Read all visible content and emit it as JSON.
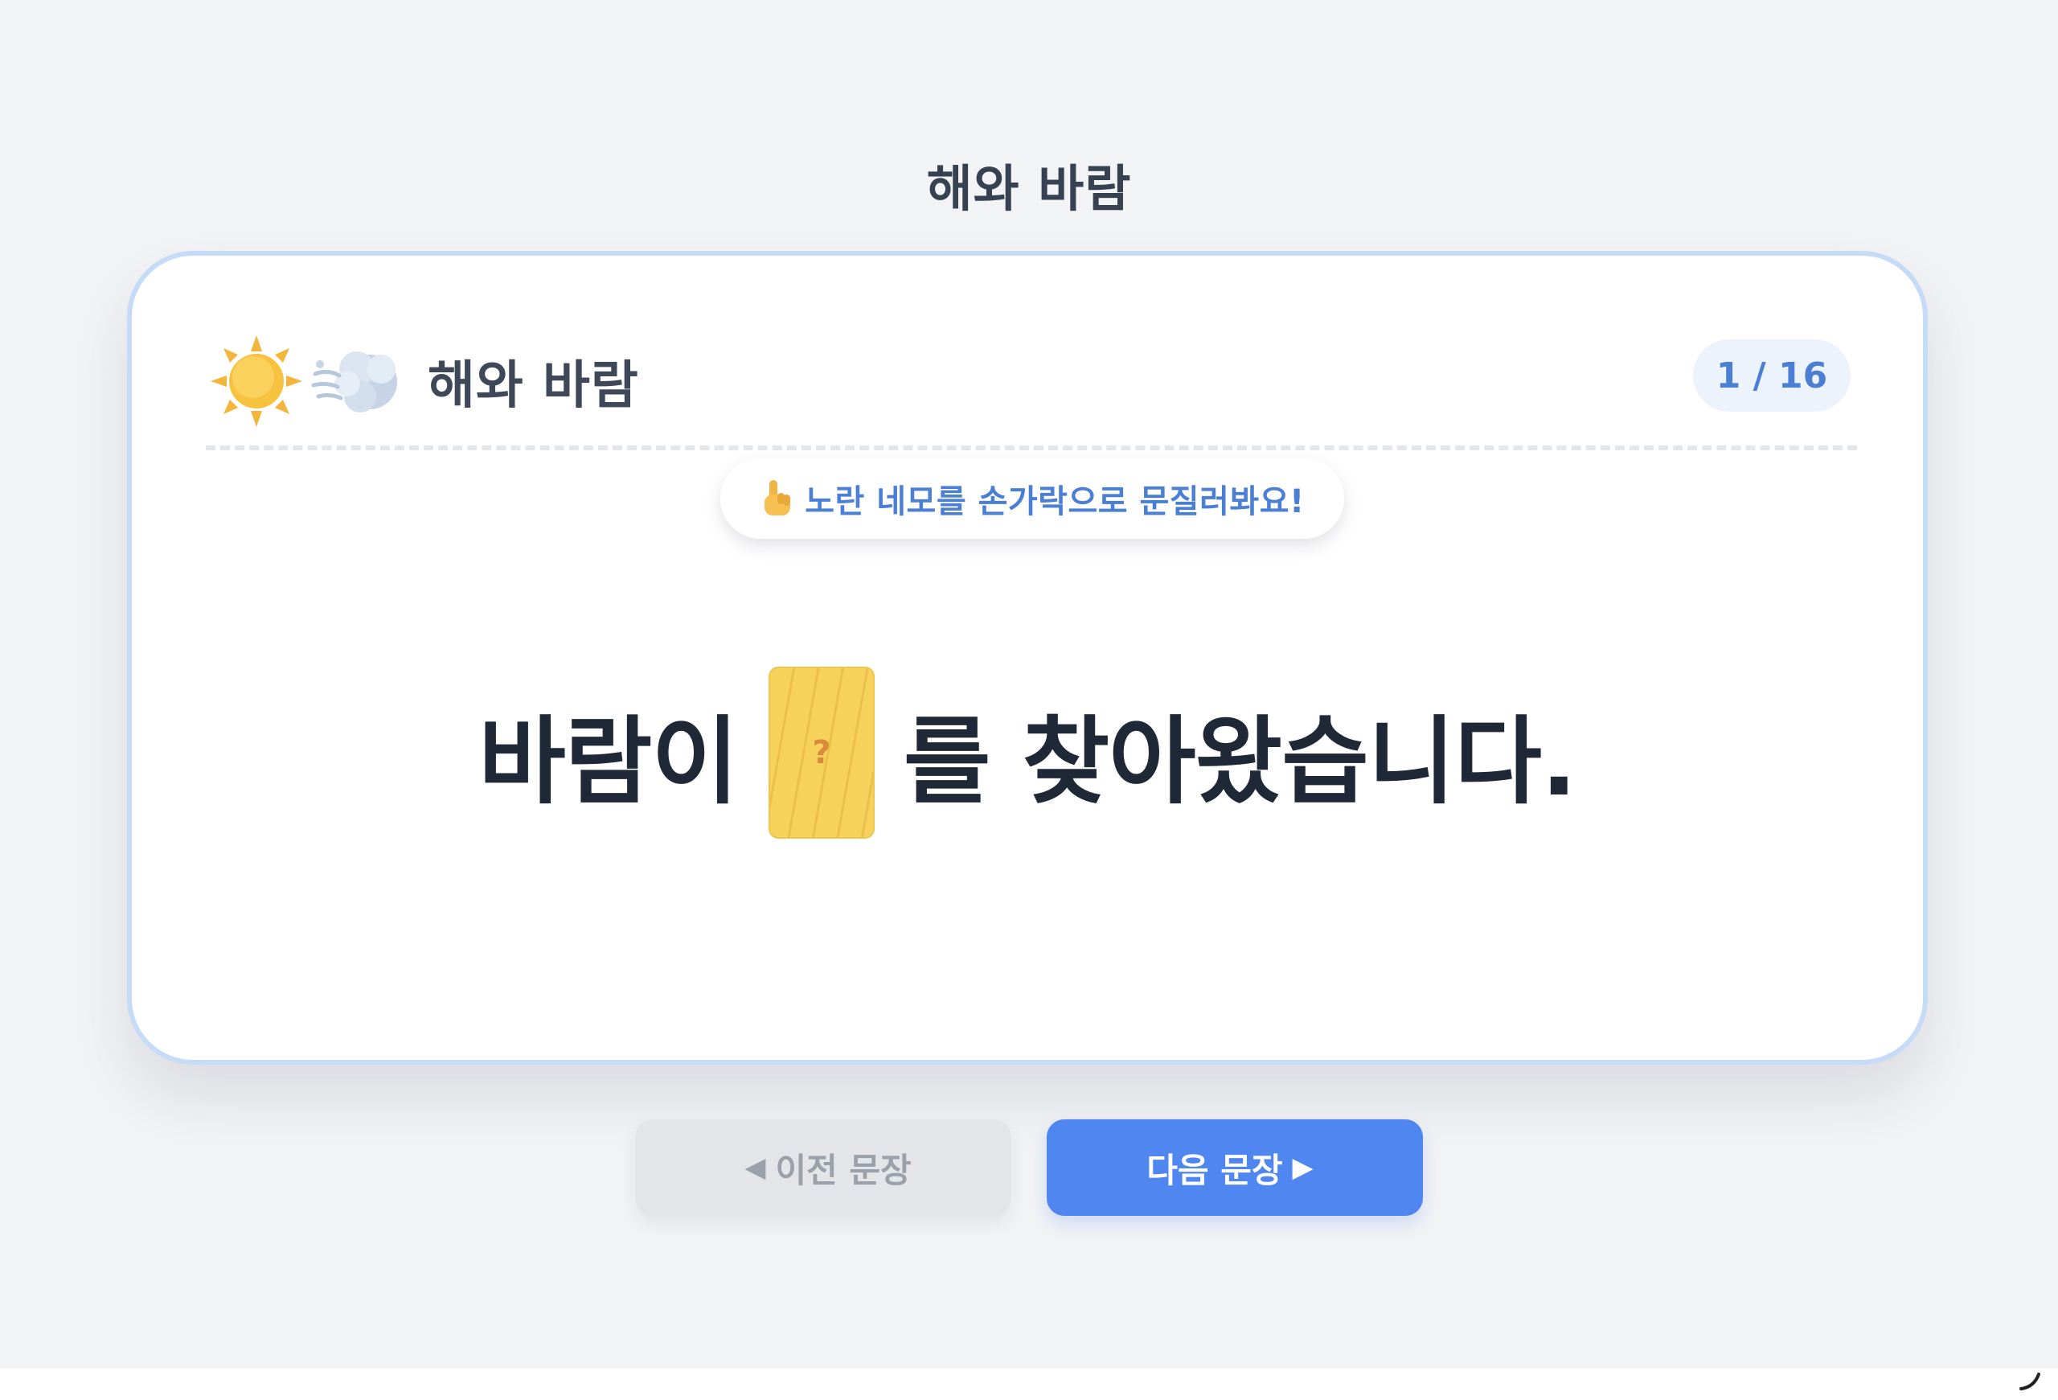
{
  "page": {
    "title": "해와 바람"
  },
  "card": {
    "icons": [
      "sun-icon",
      "wind-face-icon"
    ],
    "title": "해와 바람",
    "progress": "1 / 16",
    "hint": {
      "icon": "pointing-finger-icon",
      "text": "노란 네모를 손가락으로 문질러봐요!"
    },
    "sentence": {
      "before": "바람이",
      "blank_mark": "?",
      "after": "를 찾아왔습니다."
    }
  },
  "nav": {
    "prev_arrow": "◀",
    "prev_label": "이전 문장",
    "next_label": "다음 문장",
    "next_arrow": "▶"
  },
  "colors": {
    "background": "#f2f3f5",
    "card_border": "#c6dbf7",
    "accent": "#4f86ef",
    "blank": "#f6d25c"
  }
}
